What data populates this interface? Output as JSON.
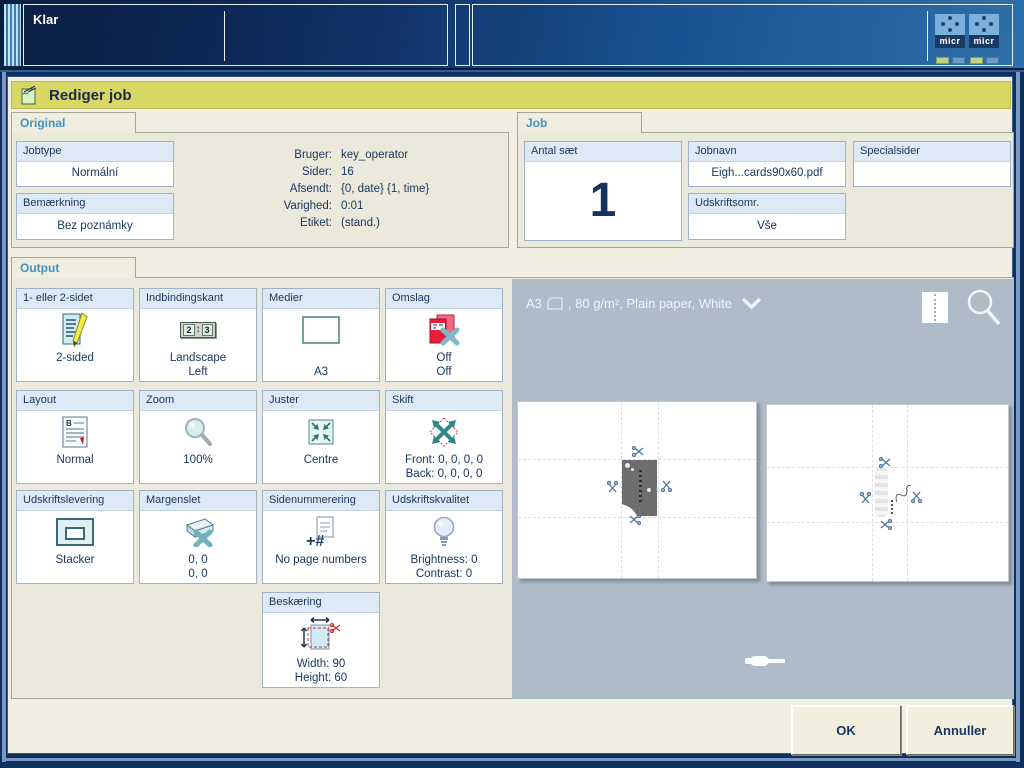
{
  "status_bar": {
    "status": "Klar",
    "micr_label": "micr"
  },
  "title_bar": {
    "title": "Rediger job"
  },
  "original": {
    "tab": "Original",
    "jobtype": {
      "label": "Jobtype",
      "value": "Normální"
    },
    "remark": {
      "label": "Bemærkning",
      "value": "Bez poznámky"
    },
    "info": {
      "rows": [
        {
          "label": "Bruger:",
          "value": "key_operator"
        },
        {
          "label": "Sider:",
          "value": "16"
        },
        {
          "label": "Afsendt:",
          "value": "{0, date} {1, time}"
        },
        {
          "label": "Varighed:",
          "value": "0:01"
        },
        {
          "label": "Etiket:",
          "value": "(stand.)"
        }
      ]
    }
  },
  "job": {
    "tab": "Job",
    "sets": {
      "label": "Antal sæt",
      "value": "1"
    },
    "jobname": {
      "label": "Jobnavn",
      "value": "Eigh...cards90x60.pdf"
    },
    "range": {
      "label": "Udskriftsomr.",
      "value": "Vše"
    },
    "special": {
      "label": "Specialsider",
      "value": ""
    }
  },
  "output": {
    "tab": "Output",
    "tiles": [
      {
        "label": "1- eller 2-sidet",
        "line1": "2-sided",
        "line2": ""
      },
      {
        "label": "Indbindingskant",
        "line1": "Landscape",
        "line2": "Left"
      },
      {
        "label": "Medier",
        "line1": "",
        "line2": "A3"
      },
      {
        "label": "Omslag",
        "line1": "Off",
        "line2": "Off"
      },
      {
        "label": "Layout",
        "line1": "Normal",
        "line2": ""
      },
      {
        "label": "Zoom",
        "line1": "100%",
        "line2": ""
      },
      {
        "label": "Juster",
        "line1": "Centre",
        "line2": ""
      },
      {
        "label": "Skift",
        "line1": "Front: 0, 0, 0, 0",
        "line2": "Back: 0, 0, 0, 0"
      },
      {
        "label": "Udskriftslevering",
        "line1": "Stacker",
        "line2": ""
      },
      {
        "label": "Margenslet",
        "line1": "0, 0",
        "line2": "0, 0"
      },
      {
        "label": "Sidenummerering",
        "line1": "No page numbers",
        "line2": ""
      },
      {
        "label": "Udskriftskvalitet",
        "line1": "Brightness: 0",
        "line2": "Contrast: 0"
      },
      {
        "label": "Beskæring",
        "line1": "Width: 90",
        "line2": "Height: 60"
      }
    ],
    "binding_icon": {
      "left": "2",
      "right": "3"
    },
    "page_numbers_glyph": "+#",
    "layout_glyph": "B",
    "preview": {
      "media_name": "A3",
      "media_details": ", 80 g/m², Plain paper, White"
    }
  },
  "footer": {
    "ok": "OK",
    "cancel": "Annuller"
  },
  "colors": {
    "title_bar": "#d6d765",
    "tab_text": "#4193c8",
    "navy_text": "#16355e",
    "preview_bg": "#aebcc9",
    "status_green": "#c3d386",
    "status_blue": "#6f9cc6"
  }
}
